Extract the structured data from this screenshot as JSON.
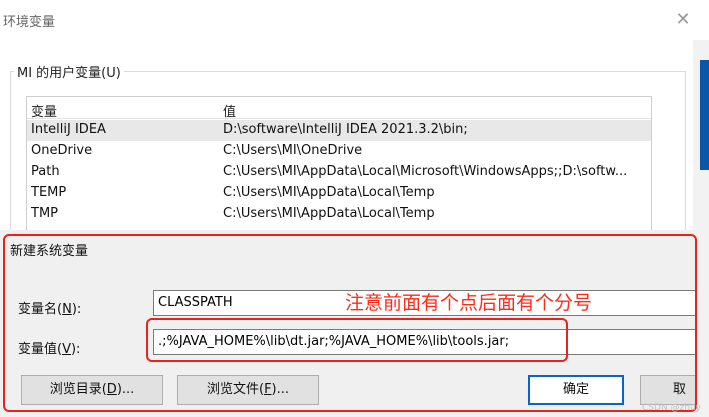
{
  "window": {
    "title": "环境变量",
    "close_glyph": "✕"
  },
  "user_vars": {
    "group_label": "MI 的用户变量(U)",
    "columns": [
      "变量",
      "值"
    ],
    "rows": [
      {
        "name": "IntelliJ IDEA",
        "value": "D:\\software\\IntelliJ IDEA 2021.3.2\\bin;",
        "selected": true
      },
      {
        "name": "OneDrive",
        "value": "C:\\Users\\MI\\OneDrive",
        "selected": false
      },
      {
        "name": "Path",
        "value": "C:\\Users\\MI\\AppData\\Local\\Microsoft\\WindowsApps;;D:\\softw...",
        "selected": false
      },
      {
        "name": "TEMP",
        "value": "C:\\Users\\MI\\AppData\\Local\\Temp",
        "selected": false
      },
      {
        "name": "TMP",
        "value": "C:\\Users\\MI\\AppData\\Local\\Temp",
        "selected": false
      }
    ]
  },
  "new_var_dialog": {
    "title": "新建系统变量",
    "name_label_pre": "变量名(",
    "name_label_key": "N",
    "name_label_post": "):",
    "name_value": "CLASSPATH",
    "value_label_pre": "变量值(",
    "value_label_key": "V",
    "value_label_post": "):",
    "value_value": ".;%JAVA_HOME%\\lib\\dt.jar;%JAVA_HOME%\\lib\\tools.jar;",
    "annotation": "注意前面有个点后面有个分号",
    "buttons": {
      "browse_dir_pre": "浏览目录(",
      "browse_dir_key": "D",
      "browse_dir_post": ")...",
      "browse_file_pre": "浏览文件(",
      "browse_file_key": "F",
      "browse_file_post": ")...",
      "ok": "确定",
      "cancel": "取消"
    }
  },
  "watermark": "CSDN @zhuy",
  "colors": {
    "annotation_red": "#e8231f",
    "primary_blue": "#0a64c8"
  }
}
